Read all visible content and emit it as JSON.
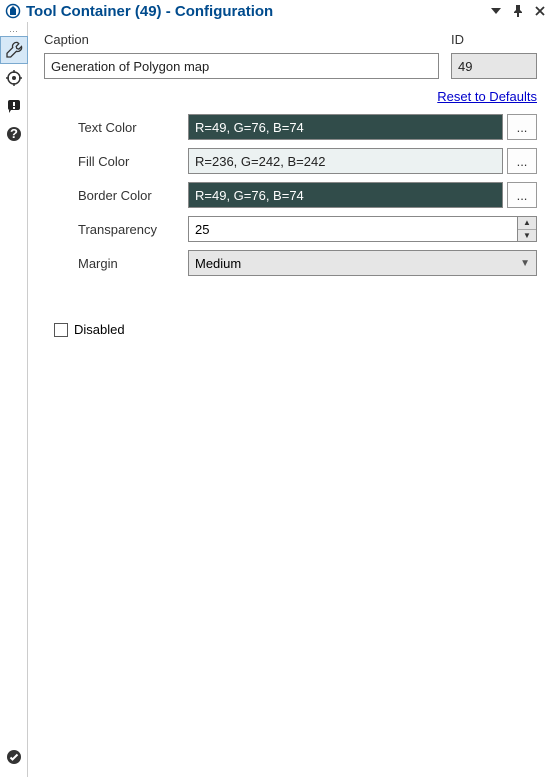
{
  "titlebar": {
    "title": "Tool Container (49) - Configuration"
  },
  "sidebar": {
    "icons": [
      "wrench-icon",
      "target-icon",
      "warning-icon",
      "help-icon"
    ],
    "bottom_icon": "check-icon"
  },
  "form": {
    "caption_label": "Caption",
    "caption_value": "Generation of Polygon map",
    "id_label": "ID",
    "id_value": "49",
    "reset_link": "Reset to Defaults",
    "rows": {
      "text_color": {
        "label": "Text Color",
        "value": "R=49, G=76, B=74",
        "hex": "#314c4a",
        "dark": true
      },
      "fill_color": {
        "label": "Fill Color",
        "value": "R=236, G=242, B=242",
        "hex": "#ecf2f2",
        "dark": false
      },
      "border_color": {
        "label": "Border Color",
        "value": "R=49, G=76, B=74",
        "hex": "#314c4a",
        "dark": true
      },
      "transparency": {
        "label": "Transparency",
        "value": "25"
      },
      "margin": {
        "label": "Margin",
        "value": "Medium"
      }
    },
    "ellipsis": "...",
    "disabled_label": "Disabled",
    "disabled_checked": false
  }
}
